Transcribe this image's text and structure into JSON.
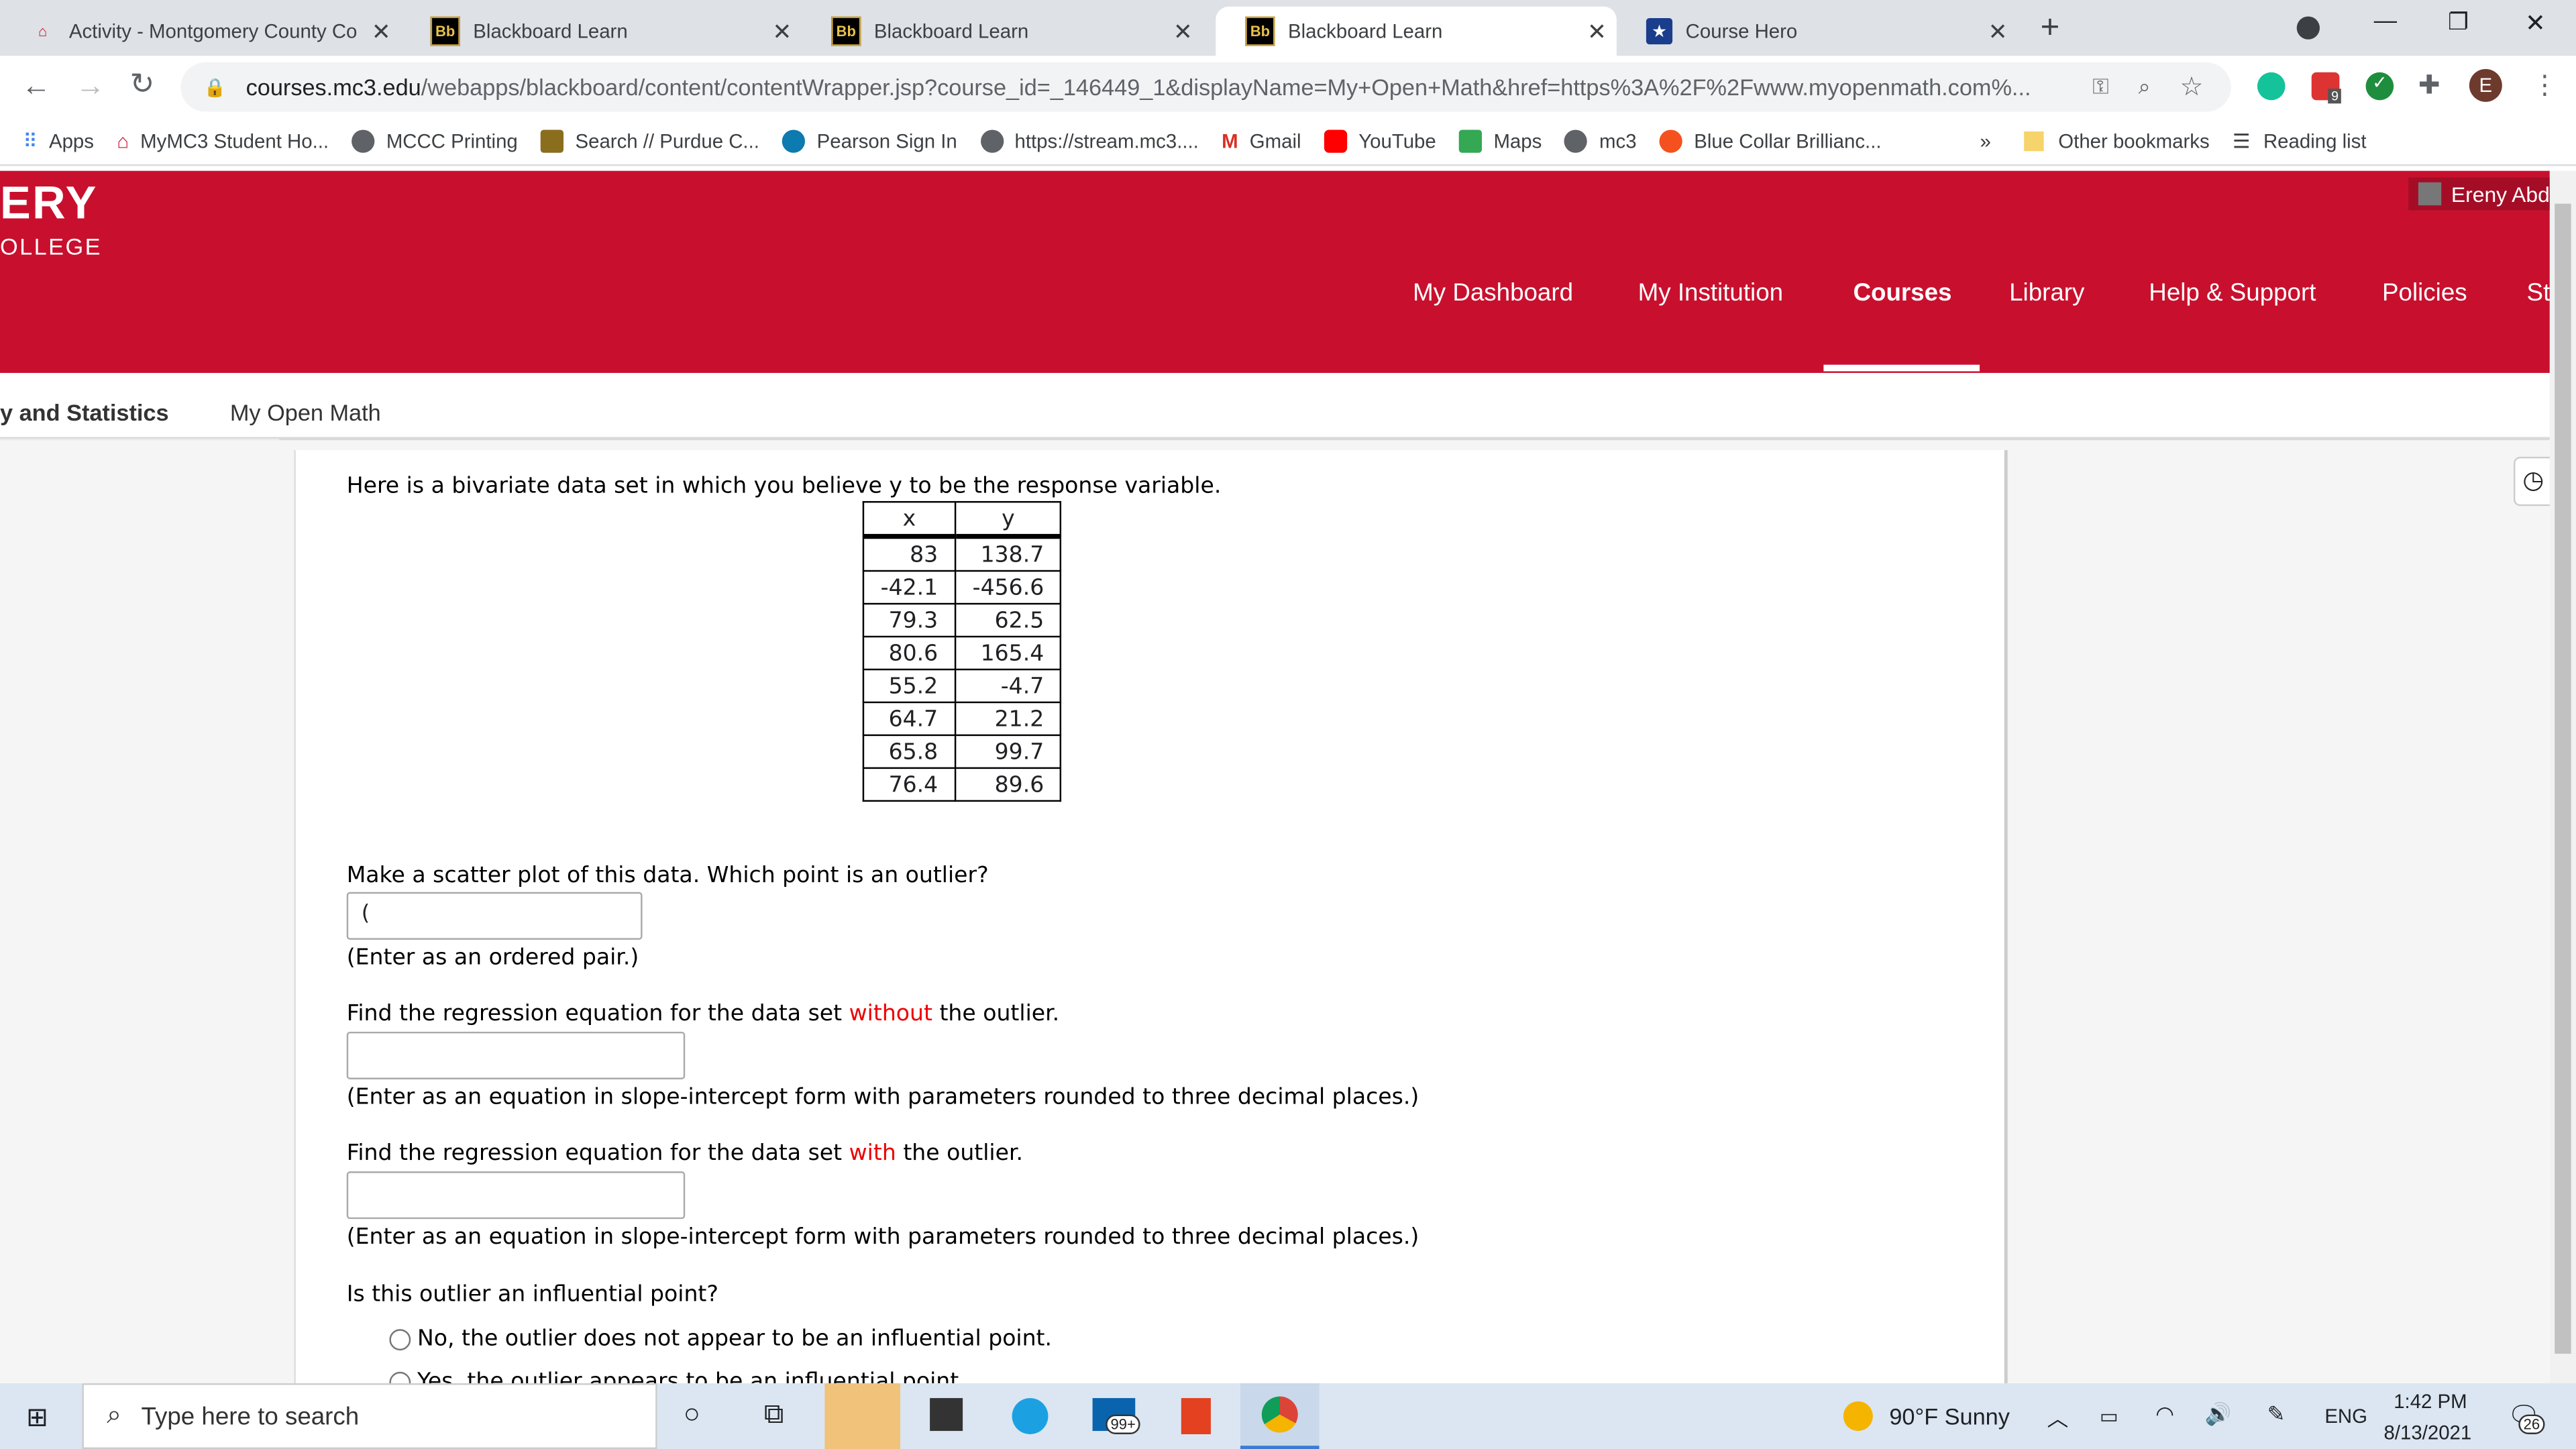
{
  "browser": {
    "tabs": [
      {
        "title": "Activity - Montgomery County Co",
        "icon": "mc3-icon"
      },
      {
        "title": "Blackboard Learn",
        "icon": "blackboard-icon"
      },
      {
        "title": "Blackboard Learn",
        "icon": "blackboard-icon"
      },
      {
        "title": "Blackboard Learn",
        "icon": "blackboard-icon",
        "active": true
      },
      {
        "title": "Course Hero",
        "icon": "coursehero-icon"
      }
    ],
    "url_host": "courses.mc3.edu",
    "url_path": "/webapps/blackboard/content/contentWrapper.jsp?course_id=_146449_1&displayName=My+Open+Math&href=https%3A%2F%2Fwww.myopenmath.com%...",
    "profile_initial": "E",
    "ext_badge": "9",
    "bookmarks": [
      "Apps",
      "MyMC3 Student Ho...",
      "MCCC Printing",
      "Search // Purdue C...",
      "Pearson Sign In",
      "https://stream.mc3....",
      "Gmail",
      "YouTube",
      "Maps",
      "mc3",
      "Blue Collar Brillianc..."
    ],
    "more_bookmarks": "»",
    "other_bookmarks": "Other bookmarks",
    "reading_list": "Reading list"
  },
  "header": {
    "logo_line1": "ERY",
    "logo_line2": "OLLEGE",
    "user": "Ereny Abd",
    "nav": [
      "My Dashboard",
      "My Institution",
      "Courses",
      "Library",
      "Help & Support",
      "Policies",
      "St"
    ],
    "active_nav": "Courses",
    "brand_color": "#c8102e"
  },
  "subnav": {
    "course": "y and Statistics",
    "link": "My Open Math"
  },
  "question": {
    "intro": "Here is a bivariate data set in which you believe y to be the response variable.",
    "headers": [
      "x",
      "y"
    ],
    "rows": [
      [
        "83",
        "138.7"
      ],
      [
        "-42.1",
        "-456.6"
      ],
      [
        "79.3",
        "62.5"
      ],
      [
        "80.6",
        "165.4"
      ],
      [
        "55.2",
        "-4.7"
      ],
      [
        "64.7",
        "21.2"
      ],
      [
        "65.8",
        "99.7"
      ],
      [
        "76.4",
        "89.6"
      ]
    ],
    "q1": "Make a scatter plot of this data. Which point is an outlier?",
    "q1_value": "(",
    "q1_hint": "(Enter as an ordered pair.)",
    "q2_pre": "Find the regression equation for the data set ",
    "q2_em": "without",
    "q2_post": " the outlier.",
    "q2_hint": "(Enter as an equation in slope-intercept form with parameters rounded to three decimal places.)",
    "q3_pre": "Find the regression equation for the data set ",
    "q3_em": "with",
    "q3_post": " the outlier.",
    "q3_hint": "(Enter as an equation in slope-intercept form with parameters rounded to three decimal places.)",
    "q4": "Is this outlier an influential point?",
    "options": [
      "No, the outlier does not appear to be an influential point.",
      "Yes, the outlier appears to be an influential point."
    ]
  },
  "taskbar": {
    "search_placeholder": "Type here to search",
    "weather": "90°F  Sunny",
    "lang": "ENG",
    "time": "1:42 PM",
    "date": "8/13/2021",
    "mail_badge": "99+",
    "notif_count": "26"
  }
}
